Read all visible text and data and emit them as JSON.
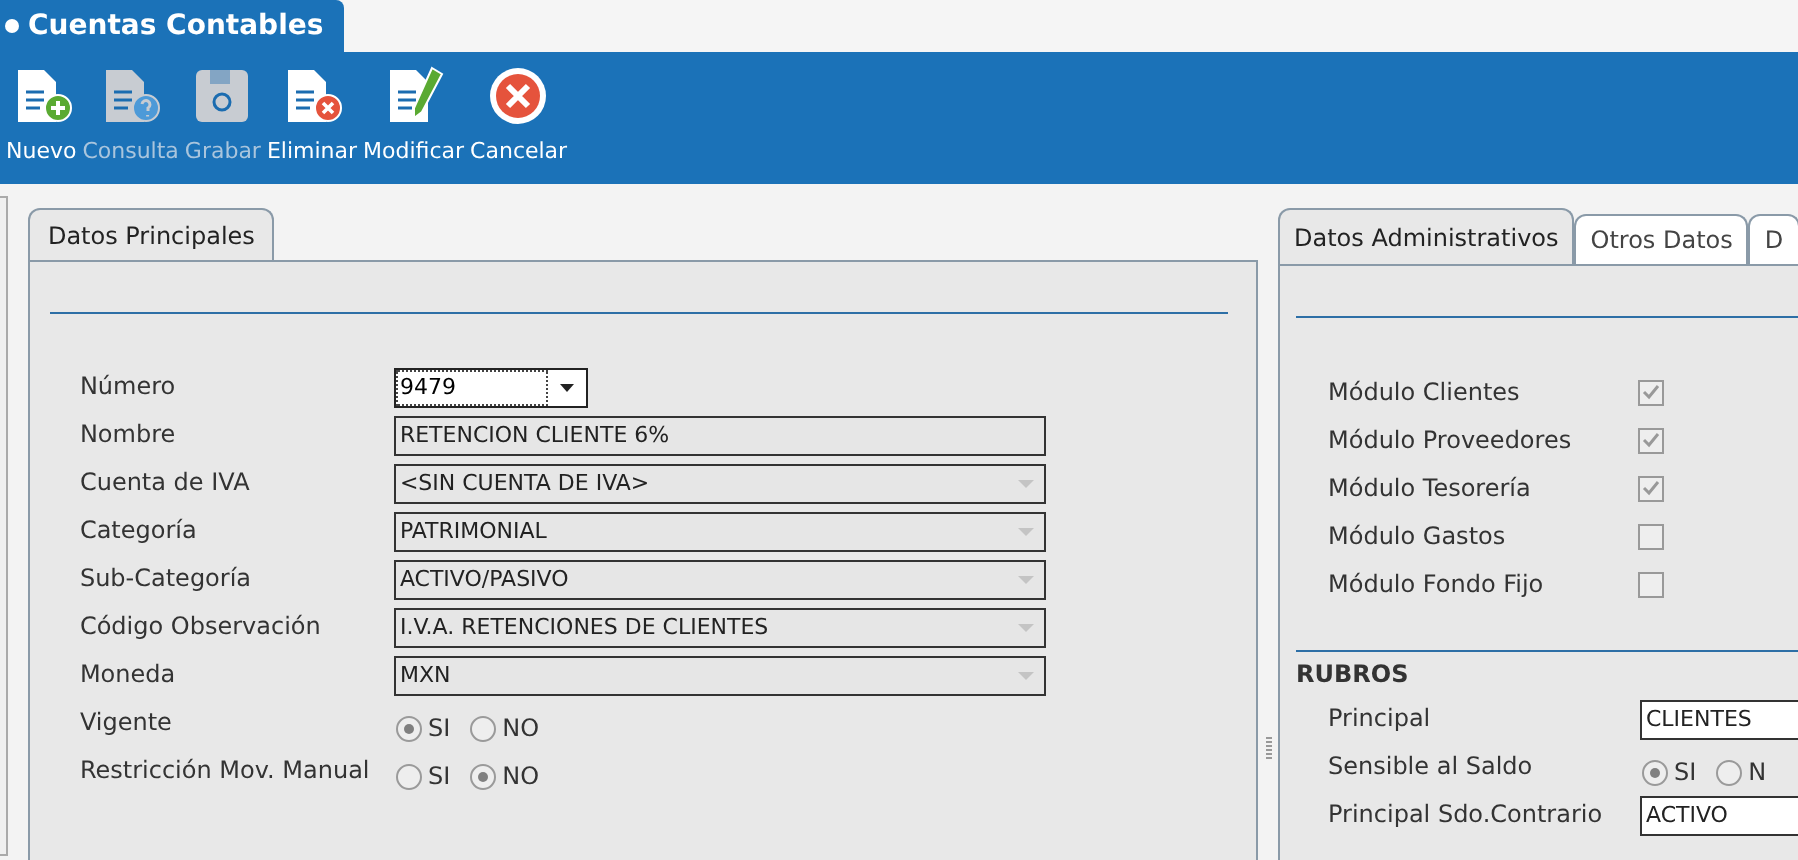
{
  "window": {
    "title": "Cuentas Contables"
  },
  "toolbar": [
    {
      "label": "Nuevo",
      "kind": "new",
      "disabled": false
    },
    {
      "label": "Consulta",
      "kind": "query",
      "disabled": true
    },
    {
      "label": "Grabar",
      "kind": "save",
      "disabled": true
    },
    {
      "label": "Eliminar",
      "kind": "delete",
      "disabled": false
    },
    {
      "label": "Modificar",
      "kind": "edit",
      "disabled": false
    },
    {
      "label": "Cancelar",
      "kind": "cancel",
      "disabled": false
    }
  ],
  "main_tabs": [
    {
      "label": "Datos Principales",
      "selected": true
    }
  ],
  "main_fields": [
    {
      "label": "Número",
      "kind": "combo",
      "value": "9479",
      "disabled": false
    },
    {
      "label": "Nombre",
      "kind": "text",
      "value": "RETENCION CLIENTE 6%",
      "disabled": true
    },
    {
      "label": "Cuenta de IVA",
      "kind": "select",
      "value": "<SIN CUENTA DE IVA>",
      "disabled": true
    },
    {
      "label": "Categoría",
      "kind": "select",
      "value": "PATRIMONIAL",
      "disabled": true
    },
    {
      "label": "Sub-Categoría",
      "kind": "select",
      "value": "ACTIVO/PASIVO",
      "disabled": true
    },
    {
      "label": "Código Observación",
      "kind": "select",
      "value": "I.V.A. RETENCIONES DE CLIENTES",
      "disabled": true
    },
    {
      "label": "Moneda",
      "kind": "select",
      "value": "MXN",
      "disabled": true
    },
    {
      "label": "Vigente",
      "kind": "radio",
      "options": [
        {
          "label": "SI",
          "selected": true
        },
        {
          "label": "NO",
          "selected": false
        }
      ]
    },
    {
      "label": "Restricción Mov. Manual",
      "kind": "radio",
      "options": [
        {
          "label": "SI",
          "selected": false
        },
        {
          "label": "NO",
          "selected": true
        }
      ]
    }
  ],
  "side_tabs": [
    {
      "label": "Datos Administrativos",
      "selected": true
    },
    {
      "label": "Otros Datos",
      "selected": false
    },
    {
      "label": "D",
      "selected": false
    }
  ],
  "modules": [
    {
      "label": "Módulo Clientes",
      "checked": true
    },
    {
      "label": "Módulo Proveedores",
      "checked": true
    },
    {
      "label": "Módulo Tesorería",
      "checked": true
    },
    {
      "label": "Módulo Gastos",
      "checked": false
    },
    {
      "label": "Módulo Fondo Fijo",
      "checked": false
    }
  ],
  "rubros": {
    "title": "RUBROS",
    "fields": [
      {
        "label": "Principal",
        "kind": "text",
        "value": "CLIENTES"
      },
      {
        "label": "Sensible al Saldo",
        "kind": "radio",
        "options": [
          {
            "label": "SI",
            "selected": true
          },
          {
            "label": "N",
            "selected": false
          }
        ]
      },
      {
        "label": "Principal Sdo.Contrario",
        "kind": "text",
        "value": "ACTIVO"
      }
    ]
  }
}
